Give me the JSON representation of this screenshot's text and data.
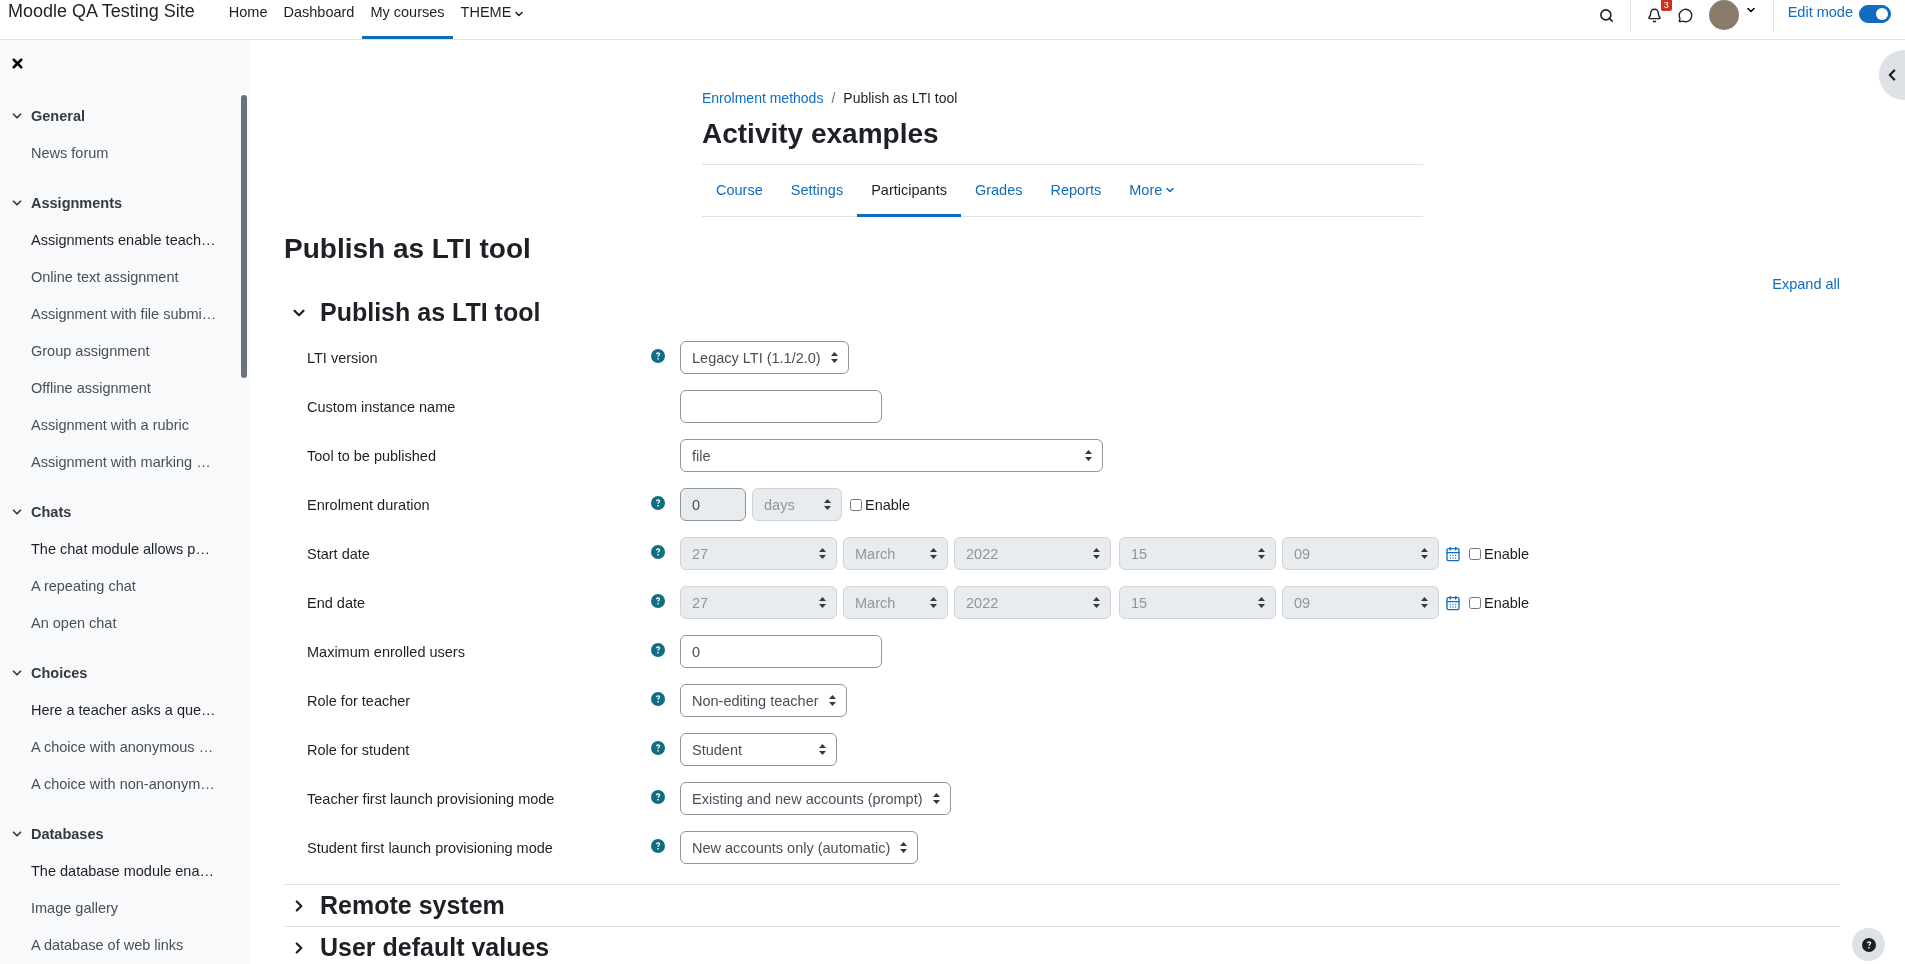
{
  "navbar": {
    "site_name": "Moodle QA Testing Site",
    "links": [
      {
        "label": "Home",
        "selected": false,
        "kind": "link"
      },
      {
        "label": "Dashboard",
        "selected": false,
        "kind": "link"
      },
      {
        "label": "My courses",
        "selected": true,
        "kind": "link"
      },
      {
        "label": "THEME",
        "selected": false,
        "kind": "menu"
      }
    ],
    "notification_count": "3",
    "edit_mode": {
      "label": "Edit mode",
      "on": true
    }
  },
  "sidebar": {
    "sections": [
      {
        "title": "General",
        "expanded": true,
        "items": [
          {
            "label": "News forum",
            "kind": "activity"
          }
        ]
      },
      {
        "title": "Assignments",
        "expanded": true,
        "items": [
          {
            "label": "Assignments enable teach…",
            "kind": "label"
          },
          {
            "label": "Online text assignment",
            "kind": "activity"
          },
          {
            "label": "Assignment with file submi…",
            "kind": "activity"
          },
          {
            "label": "Group assignment",
            "kind": "activity"
          },
          {
            "label": "Offline assignment",
            "kind": "activity"
          },
          {
            "label": "Assignment with a rubric",
            "kind": "activity"
          },
          {
            "label": "Assignment with marking …",
            "kind": "activity"
          }
        ]
      },
      {
        "title": "Chats",
        "expanded": true,
        "items": [
          {
            "label": "The chat module allows p…",
            "kind": "label"
          },
          {
            "label": "A repeating chat",
            "kind": "activity"
          },
          {
            "label": "An open chat",
            "kind": "activity"
          }
        ]
      },
      {
        "title": "Choices",
        "expanded": true,
        "items": [
          {
            "label": "Here a teacher asks a que…",
            "kind": "label"
          },
          {
            "label": "A choice with anonymous …",
            "kind": "activity"
          },
          {
            "label": "A choice with non-anonym…",
            "kind": "activity"
          }
        ]
      },
      {
        "title": "Databases",
        "expanded": true,
        "items": [
          {
            "label": "The database module ena…",
            "kind": "label"
          },
          {
            "label": "Image gallery",
            "kind": "activity"
          },
          {
            "label": "A database of web links",
            "kind": "activity"
          }
        ]
      }
    ]
  },
  "breadcrumb": {
    "separator": "/",
    "items": [
      {
        "label": "Enrolment methods",
        "kind": "link"
      },
      {
        "label": "Publish as LTI tool",
        "kind": "current"
      }
    ]
  },
  "course_title": "Activity examples",
  "course_tabs": [
    {
      "label": "Course",
      "selected": false,
      "kind": "link"
    },
    {
      "label": "Settings",
      "selected": false,
      "kind": "link"
    },
    {
      "label": "Participants",
      "selected": true,
      "kind": "link"
    },
    {
      "label": "Grades",
      "selected": false,
      "kind": "link"
    },
    {
      "label": "Reports",
      "selected": false,
      "kind": "link"
    },
    {
      "label": "More",
      "selected": false,
      "kind": "menu"
    }
  ],
  "page_title": "Publish as LTI tool",
  "expand_all": "Expand all",
  "sections": [
    {
      "title": "Publish as LTI tool",
      "expanded": true,
      "fields": [
        {
          "label": "LTI version",
          "help": true,
          "kind": "select",
          "value": "Legacy LTI (1.1/2.0)"
        },
        {
          "label": "Custom instance name",
          "help": false,
          "kind": "text"
        },
        {
          "label": "Tool to be published",
          "help": false,
          "kind": "wide-select",
          "value": "file"
        },
        {
          "label": "Enrolment duration",
          "help": true,
          "kind": "duration",
          "disabled": true,
          "value": "0",
          "unit": "days",
          "enable": {
            "label": "Enable",
            "checked": false
          }
        },
        {
          "label": "Start date",
          "help": true,
          "kind": "date",
          "disabled": true,
          "parts": [
            "27",
            "March",
            "2022",
            "15",
            "09"
          ],
          "enable": {
            "label": "Enable",
            "checked": false
          }
        },
        {
          "label": "End date",
          "help": true,
          "kind": "date",
          "disabled": true,
          "parts": [
            "27",
            "March",
            "2022",
            "15",
            "09"
          ],
          "enable": {
            "label": "Enable",
            "checked": false
          }
        },
        {
          "label": "Maximum enrolled users",
          "help": true,
          "kind": "text",
          "value": "0"
        },
        {
          "label": "Role for teacher",
          "help": true,
          "kind": "select",
          "value": "Non-editing teacher"
        },
        {
          "label": "Role for student",
          "help": true,
          "kind": "select",
          "value": "Student"
        },
        {
          "label": "Teacher first launch provisioning mode",
          "help": true,
          "kind": "select",
          "value": "Existing and new accounts (prompt)"
        },
        {
          "label": "Student first launch provisioning mode",
          "help": true,
          "kind": "select",
          "value": "New accounts only (automatic)"
        }
      ]
    },
    {
      "title": "Remote system",
      "expanded": false
    },
    {
      "title": "User default values",
      "expanded": false
    }
  ]
}
